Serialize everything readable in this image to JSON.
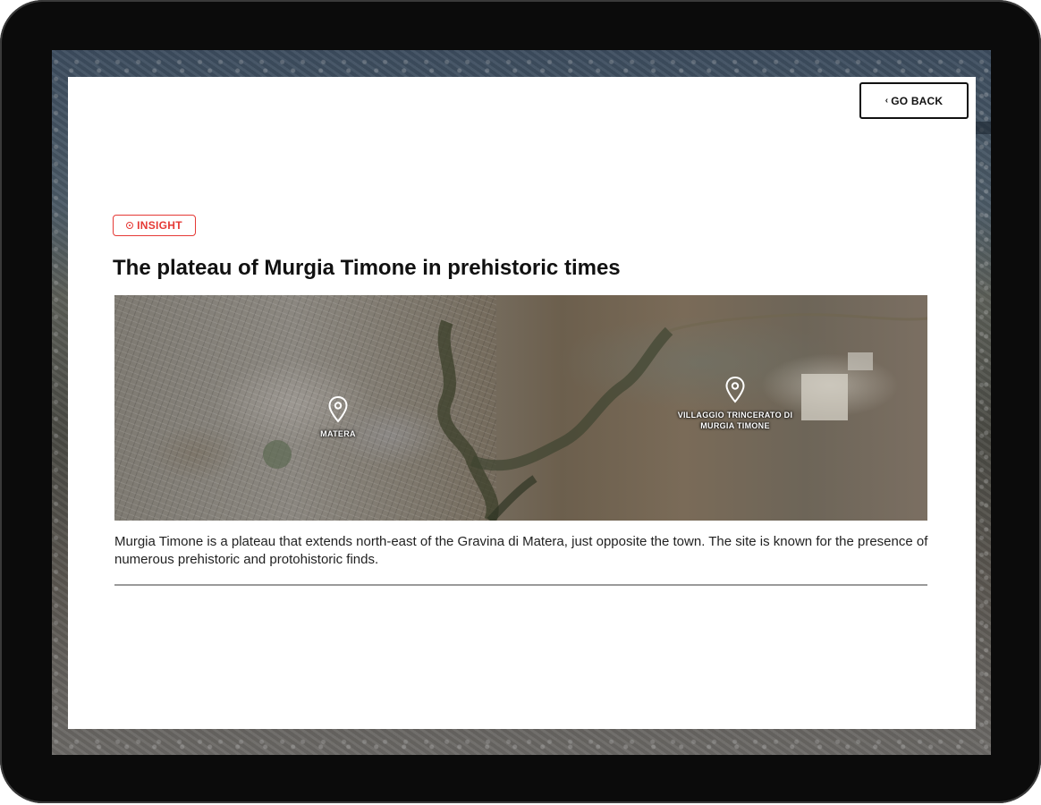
{
  "modal": {
    "go_back_label": "GO BACK",
    "badge_label": "INSIGHT",
    "title": "The plateau of Murgia Timone in prehistoric times",
    "map": {
      "pins": [
        {
          "label": "MATERA"
        },
        {
          "label": "VILLAGGIO TRINCERATO DI MURGIA TIMONE"
        }
      ]
    },
    "description": "Murgia Timone is a plateau that extends north-east of the Gravina di Matera, just opposite the town. The site is known for the presence of numerous prehistoric and protohistoric finds."
  },
  "colors": {
    "accent": "#e53935",
    "text": "#111111",
    "divider": "#9a9a9a"
  },
  "icons": [
    "chevron-left-icon",
    "target-icon",
    "map-pin-icon"
  ]
}
